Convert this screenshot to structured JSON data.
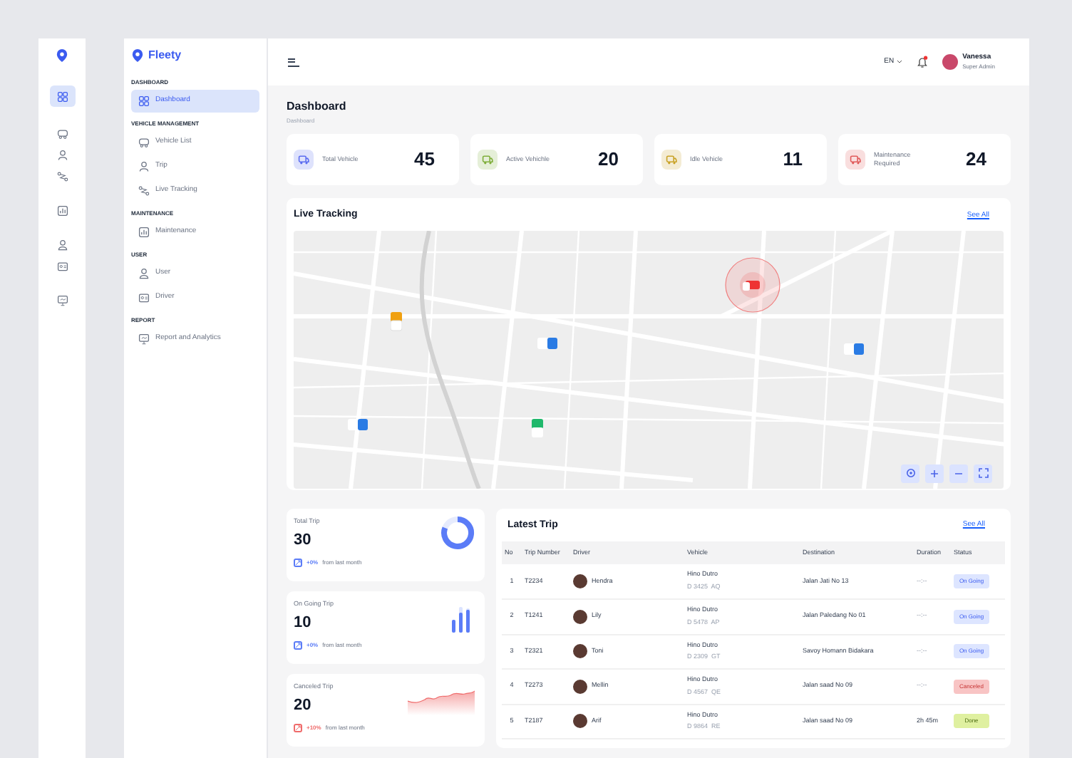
{
  "brand": {
    "name": "Fleety"
  },
  "sidebar": {
    "sections": [
      {
        "title": "DASHBOARD",
        "items": [
          {
            "label": "Dashboard",
            "selected": true
          }
        ]
      },
      {
        "title": "VEHICLE MANAGEMENT",
        "items": [
          {
            "label": "Vehicle List",
            "selected": false
          },
          {
            "label": "Trip",
            "selected": false
          },
          {
            "label": "Live Tracking",
            "selected": false
          }
        ]
      },
      {
        "title": "MAINTENANCE",
        "items": [
          {
            "label": "Maintenance",
            "selected": false
          }
        ]
      },
      {
        "title": "USER",
        "items": [
          {
            "label": "User",
            "selected": false
          },
          {
            "label": "Driver",
            "selected": false
          }
        ]
      },
      {
        "title": "REPORT",
        "items": [
          {
            "label": "Report and Analytics",
            "selected": false
          }
        ]
      }
    ]
  },
  "topbar": {
    "language": "EN",
    "notification": true,
    "user": {
      "name": "Vanessa",
      "role": "Super Admin"
    }
  },
  "page": {
    "title": "Dashboard",
    "breadcrumb": "Dashboard"
  },
  "stats": [
    {
      "label": "Total Vehicle",
      "value": "45",
      "color": "#5b6cf0"
    },
    {
      "label": "Active Vehichle",
      "value": "20",
      "color": "#7fae3a"
    },
    {
      "label": "Idle Vehicle",
      "value": "11",
      "color": "#c9a227"
    },
    {
      "label": "Maintenance Required",
      "value": "24",
      "color": "#e05a5a"
    }
  ],
  "live_tracking": {
    "title": "Live Tracking",
    "link": "See All"
  },
  "trip_cards": [
    {
      "label": "Total Trip",
      "value": "30",
      "change": "+0%",
      "note": "from last month",
      "kind": "donut",
      "color": "#5b7cf7"
    },
    {
      "label": "On Going Trip",
      "value": "10",
      "change": "+0%",
      "note": "from last month",
      "kind": "bars",
      "color": "#5b7cf7"
    },
    {
      "label": "Canceled  Trip",
      "value": "20",
      "change": "+10%",
      "note": "from last month",
      "kind": "area",
      "color": "#ef6b6b"
    }
  ],
  "latest_trip": {
    "title": "Latest Trip",
    "link": "See All",
    "columns": [
      "No",
      "Trip Number",
      "Driver",
      "Vehicle",
      "Destination",
      "Duration",
      "Status"
    ],
    "rows": [
      {
        "no": "1",
        "trip": "T2234",
        "driver": "Hendra",
        "vehicle": "Hino Dutro",
        "plate": "D 3425  AQ",
        "destination": "Jalan Jati No 13",
        "duration": "--:--",
        "status": "On Going",
        "kind": "ongoing"
      },
      {
        "no": "2",
        "trip": "T1241",
        "driver": "Lily",
        "vehicle": "Hino Dutro",
        "plate": "D 5478  AP",
        "destination": "Jalan Paledang No 01",
        "duration": "--:--",
        "status": "On Going",
        "kind": "ongoing"
      },
      {
        "no": "3",
        "trip": "T2321",
        "driver": "Toni",
        "vehicle": "Hino Dutro",
        "plate": "D 2309  GT",
        "destination": "Savoy Homann Bidakara",
        "duration": "--:--",
        "status": "On Going",
        "kind": "ongoing"
      },
      {
        "no": "4",
        "trip": "T2273",
        "driver": "Mellin",
        "vehicle": "Hino Dutro",
        "plate": "D 4567  QE",
        "destination": "Jalan saad No 09",
        "duration": "--:--",
        "status": "Canceled",
        "kind": "canceled"
      },
      {
        "no": "5",
        "trip": "T2187",
        "driver": "Arif",
        "vehicle": "Hino Dutro",
        "plate": "D 9864  RE",
        "destination": "Jalan saad No 09",
        "duration": "2h 45m",
        "status": "Done",
        "kind": "done"
      }
    ]
  }
}
